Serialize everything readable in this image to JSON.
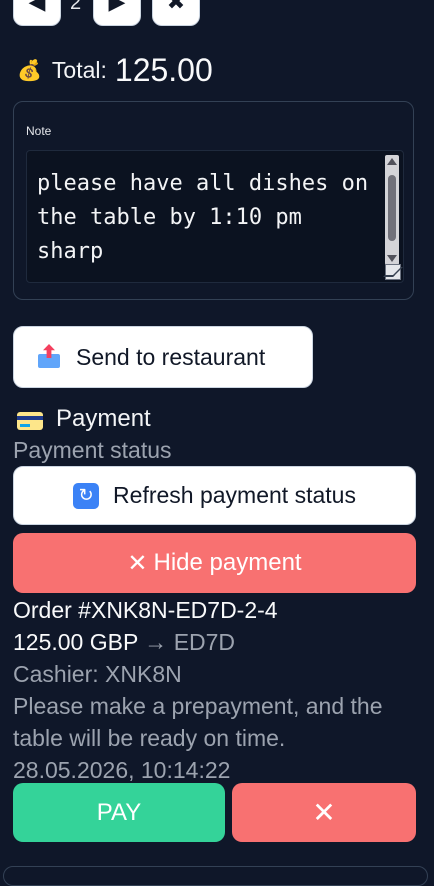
{
  "quantity_controls": {
    "decrease_icon": "chevron-left-icon",
    "quantity": "2",
    "increase_icon": "play-icon",
    "remove_icon": "close-icon"
  },
  "total": {
    "icon": "money-bag-icon",
    "label": "Total:",
    "value": "125.00"
  },
  "note": {
    "label": "Note",
    "text": "please have all dishes on the table by 1:10 pm sharp"
  },
  "send_button": {
    "icon": "outbox-tray-icon",
    "label": "Send to restaurant"
  },
  "payment": {
    "icon": "credit-card-icon",
    "title": "Payment",
    "status_label": "Payment status",
    "refresh_icon": "refresh-icon",
    "refresh_label": "Refresh payment status",
    "hide_icon": "✕",
    "hide_label": "Hide payment",
    "order_number": "Order #XNK8N-ED7D-2-4",
    "amount": "125.00 GBP",
    "arrow": "→",
    "recipient": "ED7D",
    "cashier": "Cashier: XNK8N",
    "message": "Please make a prepayment, and the table will be ready on time.",
    "timestamp": "28.05.2026, 10:14:22",
    "pay_label": "PAY",
    "cancel_label": "✕"
  },
  "colors": {
    "background": "#0f1729",
    "pay": "#34d399",
    "danger": "#f87171",
    "muted": "#9ca3af"
  }
}
